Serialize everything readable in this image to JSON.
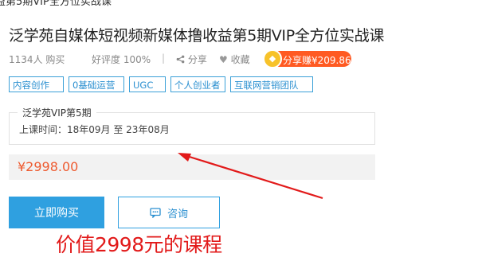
{
  "breadcrumb": "益第5期VIP全方位实战课",
  "title": "泛学苑自媒体短视频新媒体撸收益第5期VIP全方位实战课",
  "stats": {
    "purchases": "1134人 购买",
    "rating": "好评度 100%",
    "separator": "|",
    "share_label": "分享",
    "favorite_label": "收藏",
    "share_earn": "分享赚¥209.86"
  },
  "tags": [
    "内容创作",
    "0基础运营",
    "UGC",
    "个人创业者",
    "互联网营销团队"
  ],
  "schedule": {
    "legend": "泛学苑VIP第5期",
    "time_line": "上课时间：18年09月 至 23年08月"
  },
  "price": "¥2998.00",
  "buttons": {
    "buy": "立即购买",
    "consult": "咨询"
  },
  "annotation": "价值2998元的课程",
  "icons": {
    "share": "share-icon",
    "favorite": "heart-icon",
    "coin": "coin-icon",
    "chat": "chat-icon"
  },
  "colors": {
    "accent": "#2fa0e0",
    "price": "#ee5a2f",
    "annotation": "#e21a1a",
    "share_badge": "#ff5a22"
  }
}
